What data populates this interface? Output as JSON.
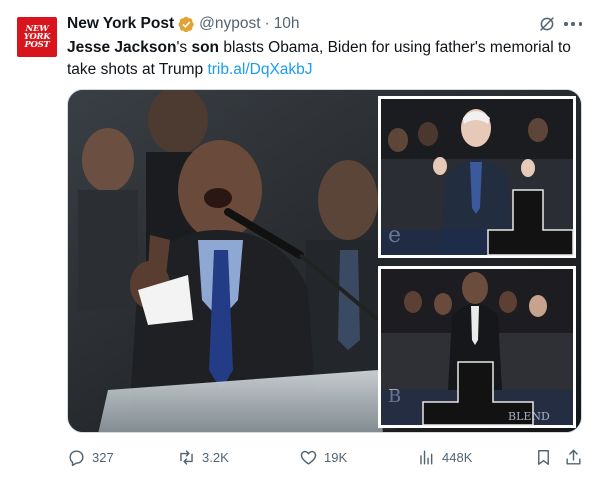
{
  "account": {
    "avatar_lines": [
      "NEW",
      "YORK",
      "POST"
    ],
    "name": "New York Post",
    "handle": "@nypost",
    "separator": "·",
    "time": "10h",
    "verified": "gold-check-badge"
  },
  "post": {
    "text_bold_1": "Jesse Jackson",
    "text_1": "'s ",
    "text_bold_2": "son",
    "text_2": " blasts Obama, Biden for using father's memorial to take shots at Trump ",
    "link": "trib.al/DqXakbJ"
  },
  "media": {
    "description_icons": [
      "photo-collage"
    ],
    "podium_text_top": "e",
    "podium_text_bottom": "BLEND"
  },
  "metrics": {
    "replies": "327",
    "reposts": "3.2K",
    "likes": "19K",
    "views": "448K"
  },
  "colors": {
    "brand_red": "#d8141c",
    "link_blue": "#1d9bf0",
    "muted": "#536471",
    "verified_gold": "#e2a336"
  }
}
